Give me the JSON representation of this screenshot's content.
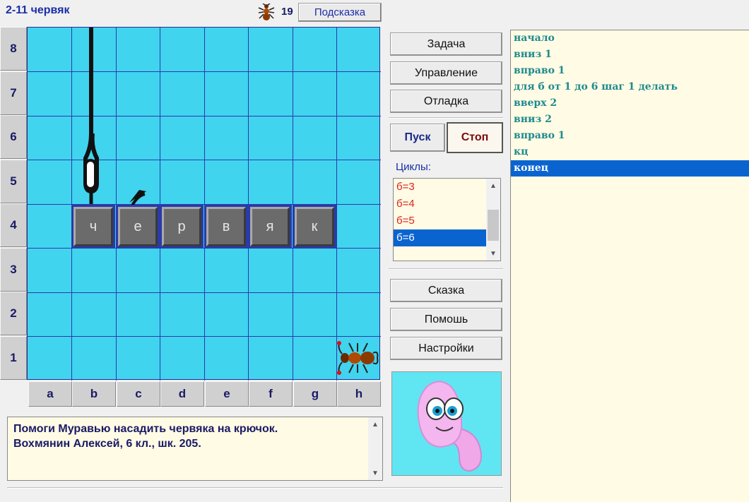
{
  "header": {
    "title": "2-11 червяк",
    "score": "19",
    "hint_label": "Подсказка",
    "ant_icon": "ant-icon"
  },
  "board": {
    "row_labels": [
      "8",
      "7",
      "6",
      "5",
      "4",
      "3",
      "2",
      "1"
    ],
    "col_labels": [
      "a",
      "b",
      "c",
      "d",
      "e",
      "f",
      "g",
      "h"
    ],
    "tiles": [
      "ч",
      "е",
      "р",
      "в",
      "я",
      "к"
    ],
    "colors": {
      "cell": "#40d4ee",
      "grid_line": "#2a3ab0",
      "tile": "#6b6b6b"
    }
  },
  "controls": {
    "task_label": "Задача",
    "control_label": "Управление",
    "debug_label": "Отладка",
    "run_label": "Пуск",
    "stop_label": "Стоп",
    "cycles_label": "Циклы:",
    "cycles": [
      "б=3",
      "б=4",
      "б=5",
      "б=6"
    ],
    "selected_cycle": "б=6",
    "tale_label": "Сказка",
    "help_label": "Помошь",
    "settings_label": "Настройки"
  },
  "message": {
    "line1": "Помоги Муравью насадить червяка на крючок.",
    "line2": "Вохмянин Алексей, 6 кл., шк. 205."
  },
  "code": [
    "начало",
    "вниз 1",
    "вправо 1",
    "для б от 1 до 6 шаг 1 делать",
    "вверх 2",
    "вниз 2",
    "вправо 1",
    "кц",
    "конец"
  ],
  "selected_code_line": "конец"
}
